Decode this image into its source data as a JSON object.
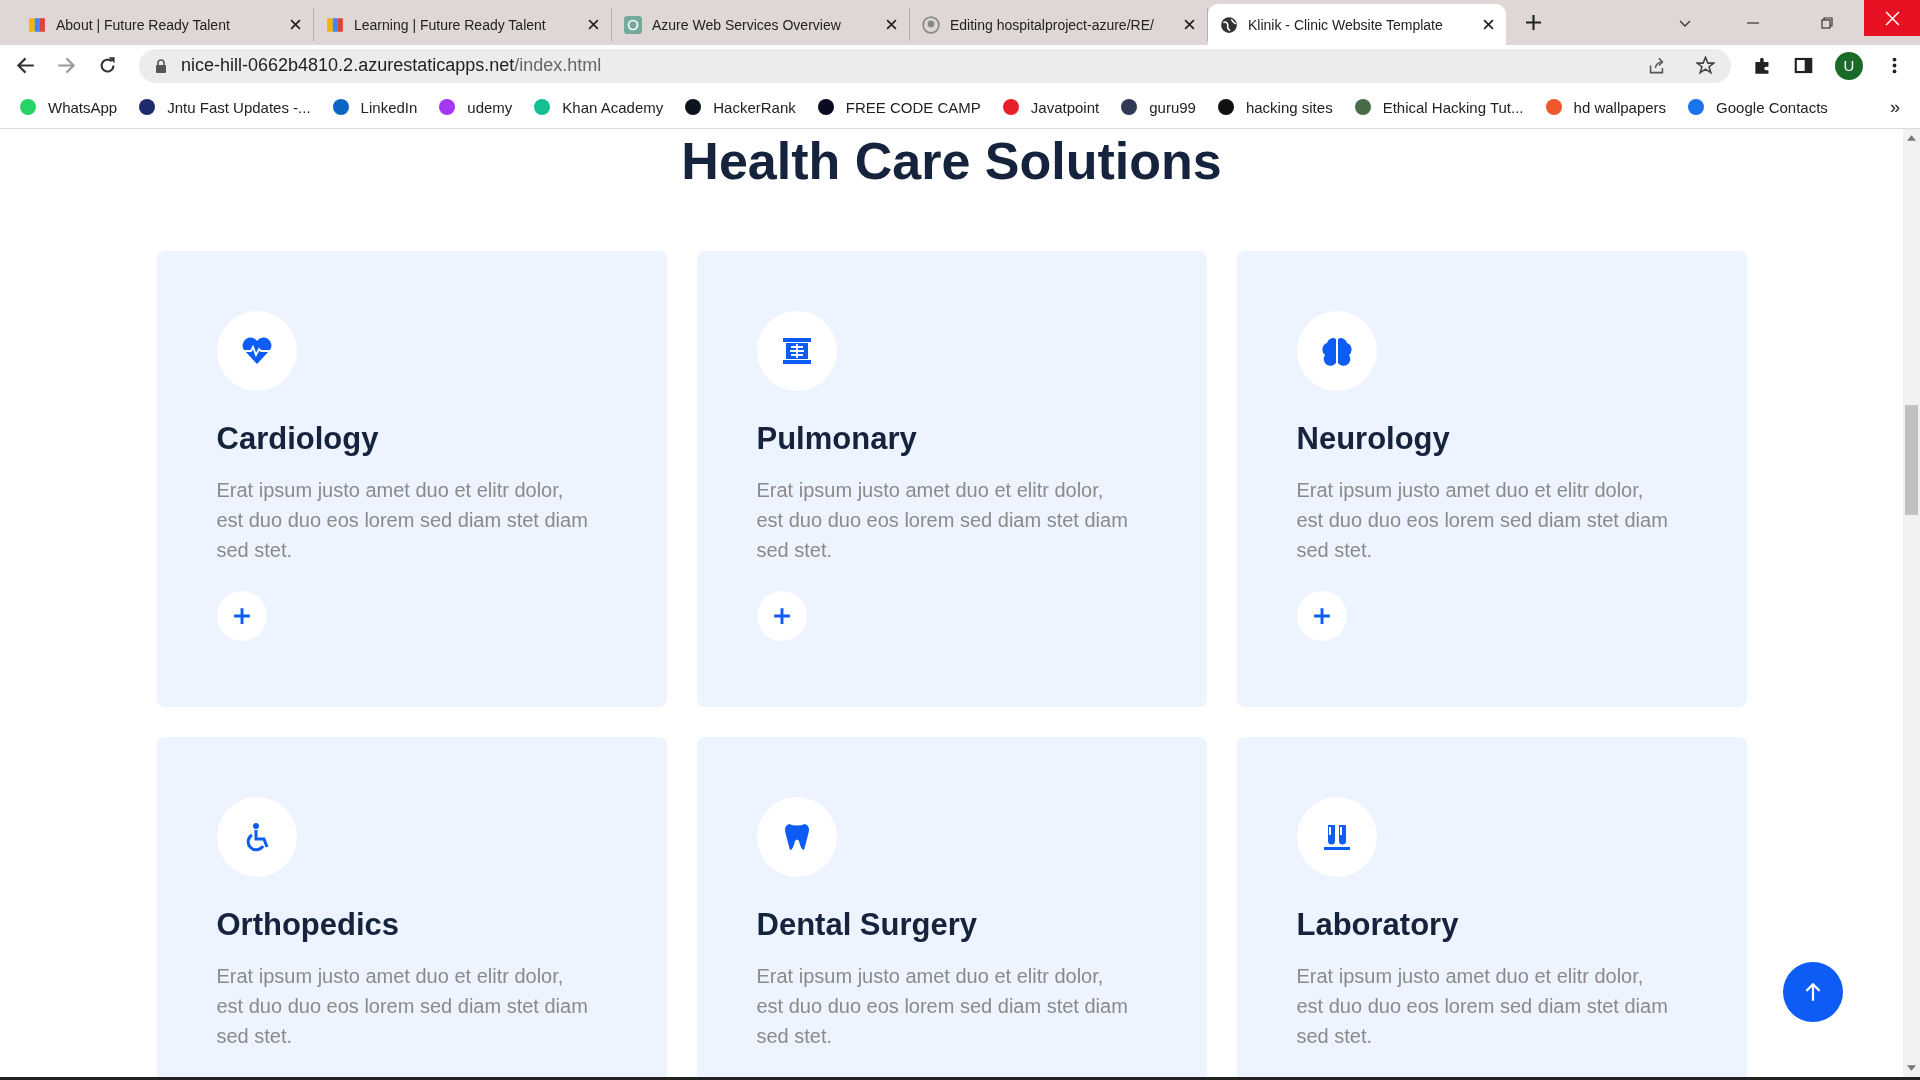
{
  "browser": {
    "tabs": [
      {
        "title": "About | Future Ready Talent",
        "kind": "logo",
        "selected": false
      },
      {
        "title": "Learning | Future Ready Talent",
        "kind": "logo",
        "selected": false
      },
      {
        "title": "Azure Web Services Overview",
        "kind": "ai",
        "selected": false
      },
      {
        "title": "Editing hospitalproject-azure/RE/",
        "kind": "github",
        "selected": false
      },
      {
        "title": "Klinik - Clinic Website Template",
        "kind": "globe",
        "selected": true
      }
    ],
    "address": {
      "host": "nice-hill-0662b4810.2.azurestaticapps.net",
      "path": "/index.html"
    },
    "profile": "U",
    "bookmarks": [
      {
        "label": "WhatsApp",
        "color": "#25d366"
      },
      {
        "label": "Jntu Fast Updates -...",
        "color": "#1e2a6b"
      },
      {
        "label": "LinkedIn",
        "color": "#0a66c2"
      },
      {
        "label": "udemy",
        "color": "#a435f0"
      },
      {
        "label": "Khan Academy",
        "color": "#14bf96"
      },
      {
        "label": "HackerRank",
        "color": "#0e141e"
      },
      {
        "label": "FREE CODE CAMP",
        "color": "#0a0a23"
      },
      {
        "label": "Javatpoint",
        "color": "#e8202a"
      },
      {
        "label": "guru99",
        "color": "#2f3a56"
      },
      {
        "label": "hacking sites",
        "color": "#111111"
      },
      {
        "label": "Ethical Hacking Tut...",
        "color": "#4a6b4a"
      },
      {
        "label": "hd wallpapers",
        "color": "#f0572b"
      },
      {
        "label": "Google Contacts",
        "color": "#1a73e8"
      }
    ],
    "more": "»"
  },
  "page": {
    "heading": "Health Care Solutions",
    "services": [
      {
        "title": "Cardiology",
        "kind": "heart",
        "text": "Erat ipsum justo amet duo et elitr dolor, est duo duo eos lorem sed diam stet diam sed stet."
      },
      {
        "title": "Pulmonary",
        "kind": "xray",
        "text": "Erat ipsum justo amet duo et elitr dolor, est duo duo eos lorem sed diam stet diam sed stet."
      },
      {
        "title": "Neurology",
        "kind": "brain",
        "text": "Erat ipsum justo amet duo et elitr dolor, est duo duo eos lorem sed diam stet diam sed stet."
      },
      {
        "title": "Orthopedics",
        "kind": "wheelchair",
        "text": "Erat ipsum justo amet duo et elitr dolor, est duo duo eos lorem sed diam stet diam sed stet."
      },
      {
        "title": "Dental Surgery",
        "kind": "tooth",
        "text": "Erat ipsum justo amet duo et elitr dolor, est duo duo eos lorem sed diam stet diam sed stet."
      },
      {
        "title": "Laboratory",
        "kind": "vials",
        "text": "Erat ipsum justo amet duo et elitr dolor, est duo duo eos lorem sed diam stet diam sed stet."
      }
    ]
  }
}
